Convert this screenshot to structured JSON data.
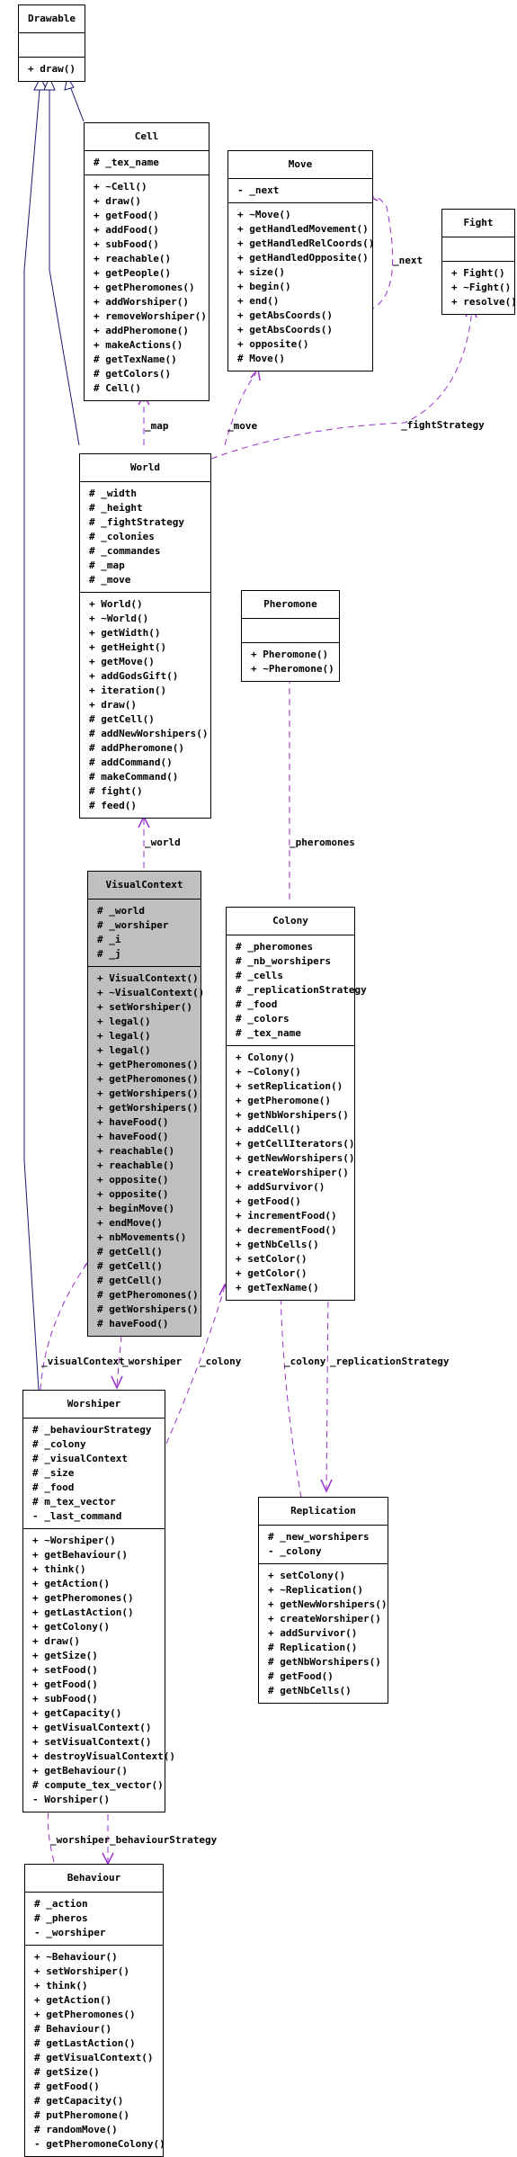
{
  "colors": {
    "inheritance": "#191970",
    "association": "#9a32cd",
    "highlight_fill": "#bfbfbf"
  },
  "classes": {
    "drawable": {
      "name": "Drawable",
      "attributes": [],
      "methods": [
        "+ draw()"
      ]
    },
    "cell": {
      "name": "Cell",
      "attributes": [
        "# _tex_name"
      ],
      "methods": [
        "+ ~Cell()",
        "+ draw()",
        "+ getFood()",
        "+ addFood()",
        "+ subFood()",
        "+ reachable()",
        "+ getPeople()",
        "+ getPheromones()",
        "+ addWorshiper()",
        "+ removeWorshiper()",
        "+ addPheromone()",
        "+ makeActions()",
        "# getTexName()",
        "# getColors()",
        "# Cell()"
      ]
    },
    "move": {
      "name": "Move",
      "attributes": [
        "- _next"
      ],
      "methods": [
        "+ ~Move()",
        "+ getHandledMovement()",
        "+ getHandledRelCoords()",
        "+ getHandledOpposite()",
        "+ size()",
        "+ begin()",
        "+ end()",
        "+ getAbsCoords()",
        "+ getAbsCoords()",
        "+ opposite()",
        "# Move()"
      ]
    },
    "fight": {
      "name": "Fight",
      "attributes": [],
      "methods": [
        "+ Fight()",
        "+ ~Fight()",
        "+ resolve()"
      ]
    },
    "world": {
      "name": "World",
      "attributes": [
        "# _width",
        "# _height",
        "# _fightStrategy",
        "# _colonies",
        "# _commandes",
        "# _map",
        "# _move"
      ],
      "methods": [
        "+ World()",
        "+ ~World()",
        "+ getWidth()",
        "+ getHeight()",
        "+ getMove()",
        "+ addGodsGift()",
        "+ iteration()",
        "+ draw()",
        "# getCell()",
        "# addNewWorshipers()",
        "# addPheromone()",
        "# addCommand()",
        "# makeCommand()",
        "# fight()",
        "# feed()"
      ]
    },
    "pheromone": {
      "name": "Pheromone",
      "attributes": [],
      "methods": [
        "+ Pheromone()",
        "+ ~Pheromone()"
      ]
    },
    "visualcontext": {
      "name": "VisualContext",
      "attributes": [
        "# _world",
        "# _worshiper",
        "# _i",
        "# _j"
      ],
      "methods": [
        "+ VisualContext()",
        "+ ~VisualContext()",
        "+ setWorshiper()",
        "+ legal()",
        "+ legal()",
        "+ legal()",
        "+ getPheromones()",
        "+ getPheromones()",
        "+ getWorshipers()",
        "+ getWorshipers()",
        "+ haveFood()",
        "+ haveFood()",
        "+ reachable()",
        "+ reachable()",
        "+ opposite()",
        "+ opposite()",
        "+ beginMove()",
        "+ endMove()",
        "+ nbMovements()",
        "# getCell()",
        "# getCell()",
        "# getCell()",
        "# getPheromones()",
        "# getWorshipers()",
        "# haveFood()"
      ]
    },
    "colony": {
      "name": "Colony",
      "attributes": [
        "# _pheromones",
        "# _nb_worshipers",
        "# _cells",
        "# _replicationStrategy",
        "# _food",
        "# _colors",
        "# _tex_name"
      ],
      "methods": [
        "+ Colony()",
        "+ ~Colony()",
        "+ setReplication()",
        "+ getPheromone()",
        "+ getNbWorshipers()",
        "+ addCell()",
        "+ getCellIterators()",
        "+ getNewWorshipers()",
        "+ createWorshiper()",
        "+ addSurvivor()",
        "+ getFood()",
        "+ incrementFood()",
        "+ decrementFood()",
        "+ getNbCells()",
        "+ setColor()",
        "+ getColor()",
        "+ getTexName()"
      ]
    },
    "worshiper": {
      "name": "Worshiper",
      "attributes": [
        "# _behaviourStrategy",
        "# _colony",
        "# _visualContext",
        "# _size",
        "# _food",
        "# m_tex_vector",
        "- _last_command"
      ],
      "methods": [
        "+ ~Worshiper()",
        "+ getBehaviour()",
        "+ think()",
        "+ getAction()",
        "+ getPheromones()",
        "+ getLastAction()",
        "+ getColony()",
        "+ draw()",
        "+ getSize()",
        "+ setFood()",
        "+ getFood()",
        "+ subFood()",
        "+ getCapacity()",
        "+ getVisualContext()",
        "+ setVisualContext()",
        "+ destroyVisualContext()",
        "+ getBehaviour()",
        "# compute_tex_vector()",
        "- Worshiper()"
      ]
    },
    "replication": {
      "name": "Replication",
      "attributes": [
        "# _new_worshipers",
        "- _colony"
      ],
      "methods": [
        "+ setColony()",
        "+ ~Replication()",
        "+ getNewWorshipers()",
        "+ createWorshiper()",
        "+ addSurvivor()",
        "# Replication()",
        "# getNbWorshipers()",
        "# getFood()",
        "# getNbCells()"
      ]
    },
    "behaviour": {
      "name": "Behaviour",
      "attributes": [
        "# _action",
        "# _pheros",
        "- _worshiper"
      ],
      "methods": [
        "+ ~Behaviour()",
        "+ setWorshiper()",
        "+ think()",
        "+ getAction()",
        "+ getPheromones()",
        "# Behaviour()",
        "# getLastAction()",
        "# getVisualContext()",
        "# getSize()",
        "# getFood()",
        "# getCapacity()",
        "# putPheromone()",
        "# randomMove()",
        "- getPheromoneColony()"
      ]
    }
  },
  "edge_labels": {
    "map": "_map",
    "move": "_move",
    "next": "_next",
    "fight": "_fightStrategy",
    "world": "_world",
    "pheromones": "_pheromones",
    "visualcontext": "_visualContext",
    "worshiper": "_worshiper",
    "colony": "_colony",
    "colony2": "_colony",
    "replication": "_replicationStrategy",
    "worshiper2": "_worshiper",
    "behaviour": "_behaviourStrategy"
  }
}
